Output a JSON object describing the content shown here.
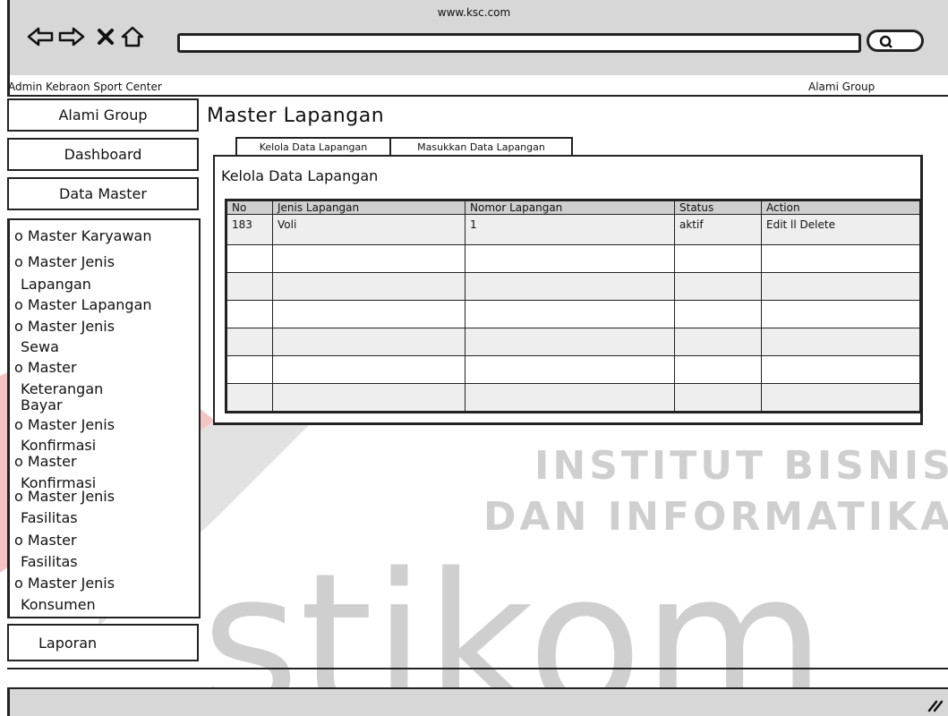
{
  "browser": {
    "url": "www.ksc.com",
    "icons": [
      "back-arrow-icon",
      "forward-arrow-icon",
      "close-x-icon",
      "home-icon",
      "search-icon"
    ]
  },
  "header": {
    "site_name": "Admin Kebraon Sport Center",
    "user": "Alami Group"
  },
  "sidebar": {
    "top_buttons": [
      {
        "label": "Alami Group"
      },
      {
        "label": "Dashboard"
      },
      {
        "label": "Data Master"
      }
    ],
    "menu_items": [
      {
        "label": "o Master Karyawan"
      },
      {
        "label": "o Master Jenis"
      },
      {
        "label": "Lapangan"
      },
      {
        "label": "o Master Lapangan"
      },
      {
        "label": "o Master Jenis"
      },
      {
        "label": "Sewa"
      },
      {
        "label": "o Master"
      },
      {
        "label": "Keterangan"
      },
      {
        "label": "Bayar"
      },
      {
        "label": "o Master Jenis"
      },
      {
        "label": "Konfirmasi"
      },
      {
        "label": "o Master"
      },
      {
        "label": "Konfirmasi"
      },
      {
        "label": "o Master Jenis"
      },
      {
        "label": "Fasilitas"
      },
      {
        "label": "o Master"
      },
      {
        "label": "Fasilitas"
      },
      {
        "label": "o Master Jenis"
      },
      {
        "label": "Konsumen"
      }
    ],
    "report_button": {
      "label": "Laporan"
    }
  },
  "main": {
    "title": "Master Lapangan",
    "tabs": [
      {
        "label": "Kelola Data Lapangan",
        "active": true
      },
      {
        "label": "Masukkan Data Lapangan",
        "active": false
      }
    ],
    "panel_title": "Kelola Data Lapangan",
    "table": {
      "columns": [
        "No",
        "Jenis Lapangan",
        "Nomor Lapangan",
        "Status",
        "Action"
      ],
      "rows": [
        [
          "183",
          "Voli",
          "1",
          "aktif",
          "Edit ll Delete"
        ],
        [
          "",
          "",
          "",
          "",
          ""
        ],
        [
          "",
          "",
          "",
          "",
          ""
        ],
        [
          "",
          "",
          "",
          "",
          ""
        ],
        [
          "",
          "",
          "",
          "",
          ""
        ],
        [
          "",
          "",
          "",
          "",
          ""
        ],
        [
          "",
          "",
          "",
          "",
          ""
        ]
      ]
    }
  },
  "watermark": {
    "line1": "INSTITUT BISNIS",
    "line2": "DAN INFORMATIKA",
    "logo_text": "stikom",
    "colors": {
      "logo_red": "#f2b8b8",
      "logo_gray": "#cfcfcf"
    }
  }
}
